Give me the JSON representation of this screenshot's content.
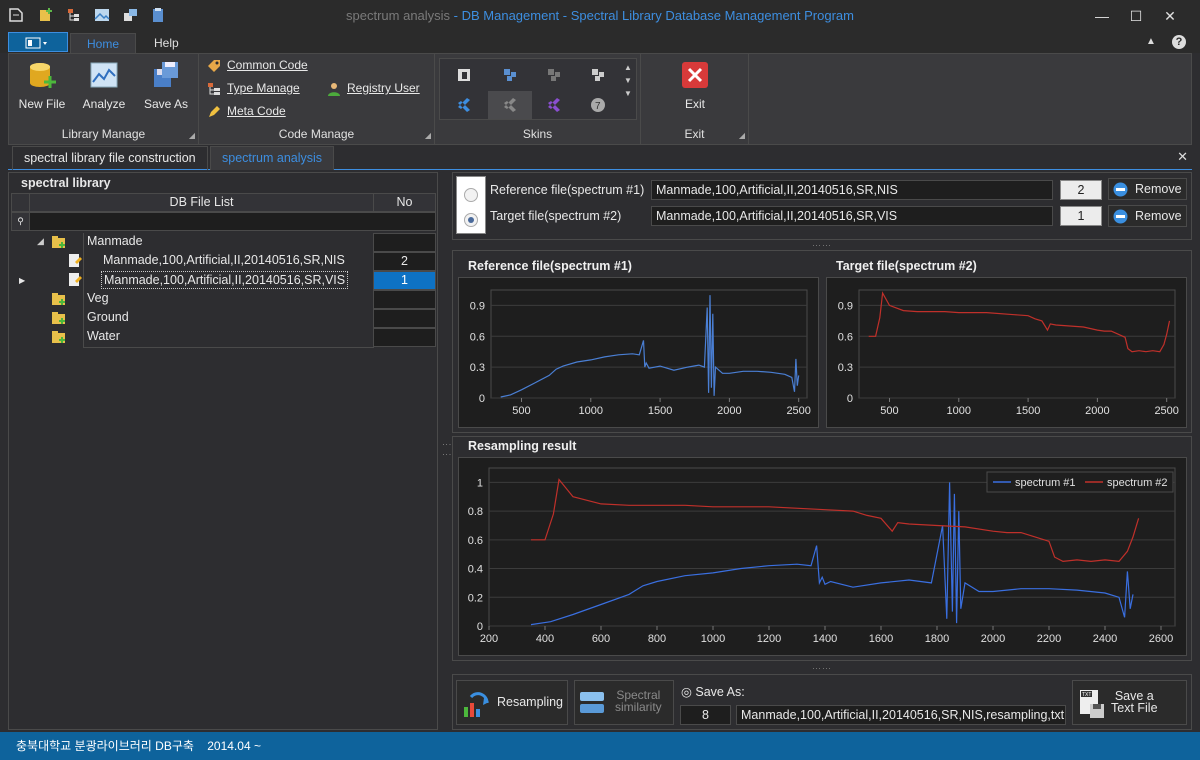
{
  "window": {
    "title_gray": "spectrum analysis",
    "title_blue": " - DB Management - Spectral Library Database Management Program"
  },
  "ribbon_tabs": {
    "home": "Home",
    "help": "Help"
  },
  "library_manage": {
    "caption": "Library Manage",
    "new_file": "New File",
    "analyze": "Analyze",
    "save_as": "Save As"
  },
  "code_manage": {
    "caption": "Code Manage",
    "common_code": "Common Code",
    "type_manage": "Type Manage",
    "meta_code": "Meta Code",
    "registry_user": "Registry User"
  },
  "skins": {
    "caption": "Skins"
  },
  "exit_group": {
    "caption": "Exit",
    "exit": "Exit"
  },
  "doc_tabs": {
    "tab1": "spectral library file construction",
    "tab2": "spectrum analysis"
  },
  "library": {
    "title": "spectral library",
    "col_file": "DB File List",
    "col_no": "No",
    "rows": [
      {
        "label": "Manmade",
        "no": ""
      },
      {
        "label": "Manmade,100,Artificial,II,20140516,SR,NIS",
        "no": "2"
      },
      {
        "label": "Manmade,100,Artificial,II,20140516,SR,VIS",
        "no": "1"
      },
      {
        "label": "Veg",
        "no": ""
      },
      {
        "label": "Ground",
        "no": ""
      },
      {
        "label": "Water",
        "no": ""
      }
    ]
  },
  "files": {
    "ref_label": "Reference file(spectrum #1)",
    "ref_value": "Manmade,100,Artificial,II,20140516,SR,NIS",
    "ref_no": "2",
    "tgt_label": "Target file(spectrum #2)",
    "tgt_value": "Manmade,100,Artificial,II,20140516,SR,VIS",
    "tgt_no": "1",
    "remove": "Remove"
  },
  "chart_titles": {
    "ref": "Reference file(spectrum #1)",
    "tgt": "Target file(spectrum #2)",
    "res": "Resampling result"
  },
  "chart_data": [
    {
      "type": "line",
      "title": "Reference file(spectrum #1)",
      "xlim": [
        280,
        2560
      ],
      "ylim": [
        0,
        1.05
      ],
      "xticks": [
        500,
        1000,
        1500,
        2000,
        2500
      ],
      "yticks": [
        0,
        0.3,
        0.6,
        0.9
      ],
      "color": "#4a7fd4",
      "series": [
        {
          "x": [
            350,
            420,
            500,
            600,
            700,
            750,
            800,
            900,
            1000,
            1100,
            1200,
            1300,
            1350,
            1380,
            1390,
            1400,
            1420,
            1500,
            1600,
            1700,
            1780,
            1820,
            1840,
            1850,
            1860,
            1870,
            1880,
            1890,
            1900,
            1950,
            2000,
            2100,
            2200,
            2300,
            2400,
            2450,
            2470,
            2480,
            2490,
            2500
          ],
          "y": [
            0.01,
            0.03,
            0.08,
            0.15,
            0.22,
            0.28,
            0.31,
            0.35,
            0.37,
            0.4,
            0.42,
            0.43,
            0.42,
            0.56,
            0.3,
            0.34,
            0.29,
            0.31,
            0.27,
            0.3,
            0.32,
            0.3,
            0.88,
            0.05,
            1.0,
            0.1,
            0.82,
            0.02,
            0.3,
            0.24,
            0.24,
            0.26,
            0.26,
            0.25,
            0.23,
            0.2,
            0.06,
            0.38,
            0.12,
            0.22
          ]
        }
      ]
    },
    {
      "type": "line",
      "title": "Target file(spectrum #2)",
      "xlim": [
        280,
        2560
      ],
      "ylim": [
        0,
        1.05
      ],
      "xticks": [
        500,
        1000,
        1500,
        2000,
        2500
      ],
      "yticks": [
        0,
        0.3,
        0.6,
        0.9
      ],
      "color": "#c0302a",
      "series": [
        {
          "x": [
            350,
            400,
            430,
            450,
            500,
            600,
            700,
            800,
            900,
            1000,
            1200,
            1400,
            1500,
            1550,
            1600,
            1640,
            1660,
            1700,
            1800,
            1900,
            2000,
            2050,
            2100,
            2150,
            2200,
            2220,
            2250,
            2300,
            2350,
            2400,
            2450,
            2480,
            2500,
            2520
          ],
          "y": [
            0.6,
            0.6,
            0.78,
            1.02,
            0.9,
            0.85,
            0.84,
            0.84,
            0.84,
            0.83,
            0.83,
            0.81,
            0.8,
            0.77,
            0.75,
            0.66,
            0.72,
            0.71,
            0.7,
            0.69,
            0.66,
            0.65,
            0.65,
            0.62,
            0.59,
            0.48,
            0.45,
            0.46,
            0.45,
            0.46,
            0.45,
            0.52,
            0.62,
            0.75
          ]
        }
      ]
    },
    {
      "type": "line",
      "title": "Resampling result",
      "xlim": [
        200,
        2650
      ],
      "ylim": [
        0,
        1.1
      ],
      "xticks": [
        200,
        400,
        600,
        800,
        1000,
        1200,
        1400,
        1600,
        1800,
        2000,
        2200,
        2400,
        2600
      ],
      "yticks": [
        0,
        0.2,
        0.4,
        0.6,
        0.8,
        1
      ],
      "legend": "top-right",
      "series": [
        {
          "name": "spectrum #1",
          "color": "#3a6fe0",
          "x": [
            350,
            420,
            500,
            600,
            700,
            750,
            800,
            900,
            1000,
            1100,
            1200,
            1300,
            1350,
            1370,
            1380,
            1390,
            1400,
            1420,
            1500,
            1600,
            1700,
            1780,
            1820,
            1835,
            1845,
            1855,
            1862,
            1870,
            1878,
            1885,
            1900,
            1950,
            2000,
            2100,
            2200,
            2300,
            2400,
            2450,
            2470,
            2480,
            2490,
            2500
          ],
          "y": [
            0.01,
            0.03,
            0.08,
            0.15,
            0.22,
            0.28,
            0.31,
            0.35,
            0.37,
            0.4,
            0.42,
            0.43,
            0.42,
            0.56,
            0.3,
            0.34,
            0.29,
            0.31,
            0.27,
            0.3,
            0.32,
            0.3,
            0.7,
            0.05,
            1.0,
            0.1,
            0.92,
            0.02,
            0.8,
            0.12,
            0.3,
            0.24,
            0.24,
            0.26,
            0.26,
            0.25,
            0.23,
            0.2,
            0.06,
            0.38,
            0.12,
            0.22
          ]
        },
        {
          "name": "spectrum #2",
          "color": "#c0302a",
          "x": [
            350,
            400,
            430,
            450,
            500,
            600,
            700,
            800,
            900,
            1000,
            1200,
            1400,
            1500,
            1550,
            1600,
            1640,
            1660,
            1700,
            1800,
            1900,
            2000,
            2050,
            2100,
            2150,
            2200,
            2220,
            2250,
            2300,
            2350,
            2400,
            2450,
            2480,
            2500,
            2520
          ],
          "y": [
            0.6,
            0.6,
            0.78,
            1.02,
            0.9,
            0.85,
            0.84,
            0.84,
            0.84,
            0.83,
            0.83,
            0.81,
            0.8,
            0.77,
            0.75,
            0.66,
            0.72,
            0.71,
            0.7,
            0.69,
            0.66,
            0.65,
            0.65,
            0.62,
            0.59,
            0.48,
            0.45,
            0.46,
            0.45,
            0.46,
            0.45,
            0.52,
            0.62,
            0.75
          ]
        }
      ]
    }
  ],
  "bottom": {
    "resampling": "Resampling",
    "similarity_l1": "Spectral",
    "similarity_l2": "similarity",
    "save_as_label": "◎ Save As:",
    "save_no": "8",
    "save_name": "Manmade,100,Artificial,II,20140516,SR,NIS,resampling,txt",
    "save_text_l1": "Save a",
    "save_text_l2": "Text File"
  },
  "status": {
    "text": "충북대학교 분광라이브러리 DB구축    2014.04 ~"
  }
}
